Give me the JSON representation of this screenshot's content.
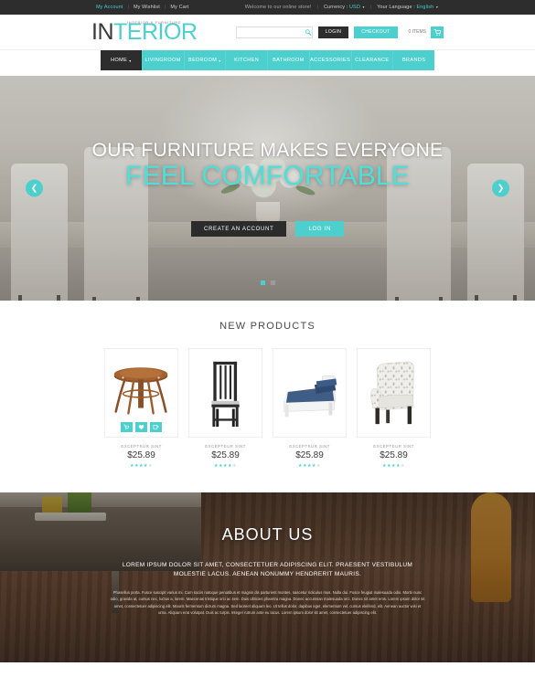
{
  "topbar": {
    "links": [
      {
        "label": "My Account",
        "style": "teal"
      },
      {
        "label": "My Wishlist",
        "style": "plain"
      },
      {
        "label": "My Cart",
        "style": "plain"
      }
    ],
    "welcome": "Welcome to our online store!",
    "currency_label": "Currency :",
    "currency_value": "USD",
    "language_label": "Your Language :",
    "language_value": "English",
    "caret": "▾"
  },
  "header": {
    "logo_in": "IN",
    "logo_terior": "TERIOR",
    "logo_tagline": "INTERIOR & FURNITURE",
    "search_placeholder": "",
    "search_value": "",
    "search_icon": "search-icon",
    "login_label": "LOGIN",
    "checkout_label": "CHECKOUT",
    "cart_count_label": "0 ITEMS",
    "cart_icon": "shopping-cart-icon"
  },
  "nav": {
    "items": [
      {
        "label": "HOME",
        "active": true,
        "caret": "▾"
      },
      {
        "label": "LIVINGROOM",
        "active": false,
        "caret": ""
      },
      {
        "label": "BEDROOM",
        "active": false,
        "caret": "▾"
      },
      {
        "label": "KITCHEN",
        "active": false,
        "caret": ""
      },
      {
        "label": "BATHROOM",
        "active": false,
        "caret": ""
      },
      {
        "label": "ACCESSORIES",
        "active": false,
        "caret": ""
      },
      {
        "label": "CLEARANCE",
        "active": false,
        "caret": ""
      },
      {
        "label": "BRANDS",
        "active": false,
        "caret": ""
      }
    ]
  },
  "hero": {
    "line1": "OUR FURNITURE MAKES EVERYONE",
    "line2": "FEEL COMFORTABLE",
    "btn_account": "CREATE AN ACCOUNT",
    "btn_login": "LOG IN",
    "prev_icon": "❮",
    "next_icon": "❯",
    "slides": 2,
    "active_slide": 1,
    "accent_color": "#4dd0cd"
  },
  "products": {
    "title": "NEW PRODUCTS",
    "action_icons": [
      "cart-icon",
      "heart-icon",
      "compare-icon"
    ],
    "items": [
      {
        "name": "EXCEPTEUR SINT",
        "price": "$25.89",
        "rating": 4,
        "art": "table"
      },
      {
        "name": "EXCEPTEUR SINT",
        "price": "$25.89",
        "rating": 4,
        "art": "chair"
      },
      {
        "name": "EXCEPTEUR SINT",
        "price": "$25.89",
        "rating": 4,
        "art": "bed"
      },
      {
        "name": "EXCEPTEUR SINT",
        "price": "$25.89",
        "rating": 4,
        "art": "armchair"
      }
    ],
    "star_filled": "★",
    "star_empty": "★"
  },
  "about": {
    "title": "ABOUT US",
    "lead": "LOREM IPSUM DOLOR SIT AMET, CONSECTETUER ADIPISCING ELIT. PRAESENT VESTIBULUM MOLESTIE LACUS. AENEAN NONUMMY HENDRERIT MAURIS.",
    "body": "Phasellus porta. Fusce suscipit varius mi. Cum sociis natoque penatibus et magnis dis parturient montes, nascetur ridiculus mus. Nulla dui. Fusce feugiat malesuada odio. Morbi nunc odio, gravida at, cursus nec, luctus a, lorem. Maecenas tristique orci ac sem. Duis ultricies pharetra magna. Donec accumsan malesuada orci. Donec sit amet eros. Lorem ipsum dolor sit amet, consectetuer adipiscing elit. Mauris fermentum dictum magna. Sed laoreet aliquam leo. Ut tellus dolor, dapibus eget, elementum vel, cursus eleifend, elit. Aenean auctor wisi et urna. Aliquam erat volutpat. Duis ac turpis. Integer rutrum ante eu lacus. Lorem ipsum dolor sit amet, consectetuer adipiscing elit."
  }
}
